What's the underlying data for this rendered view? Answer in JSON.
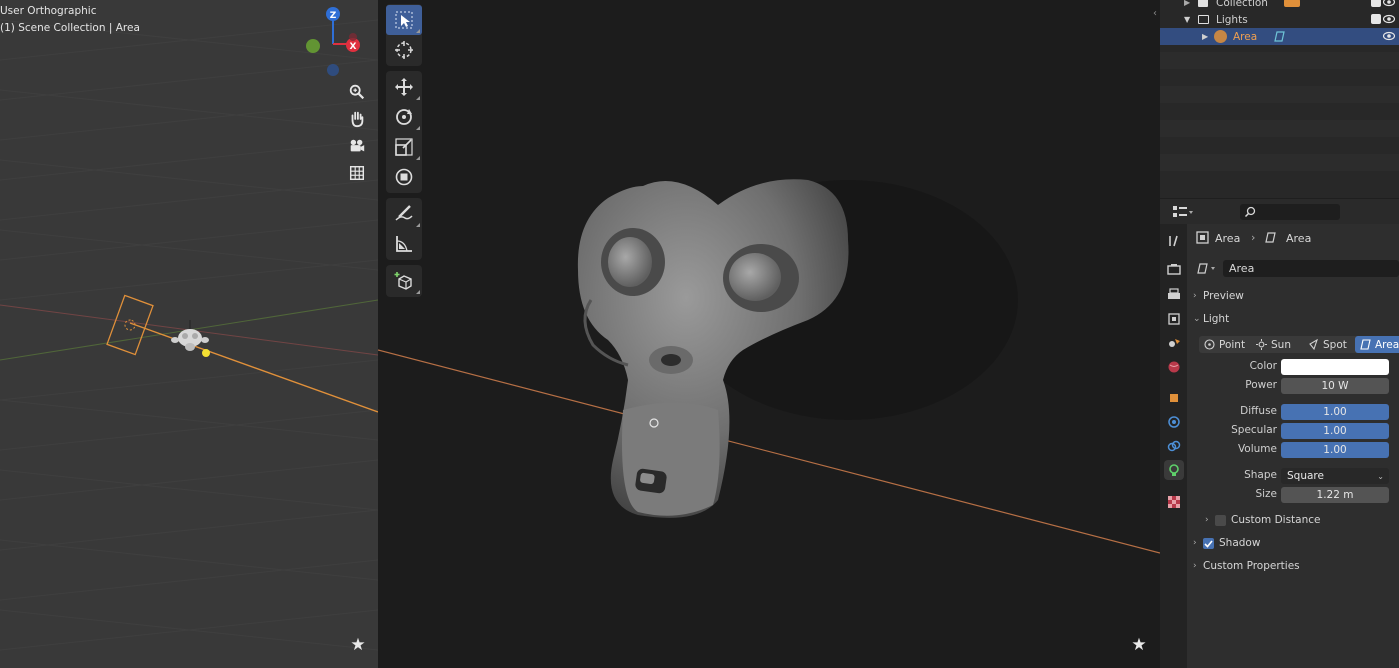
{
  "viewport_left": {
    "view_name": "User Orthographic",
    "collection_info": "(1) Scene Collection | Area",
    "gizmo": {
      "z_label": "Z",
      "x_label": "X",
      "z_color": "#2f6fd6",
      "x_color": "#e0303f",
      "y_color": "#6aa432"
    },
    "nav_icons": [
      "zoom-icon",
      "hand-pan-icon",
      "camera-icon",
      "grid-icon"
    ],
    "star_glyph": "★"
  },
  "viewport_center": {
    "tools": [
      "select-box",
      "cursor",
      "move",
      "rotate",
      "scale",
      "transform",
      "annotate",
      "measure",
      "add-cube"
    ],
    "star_glyph": "★"
  },
  "outliner": {
    "rows": [
      {
        "label": "Collection"
      },
      {
        "label": "Lights"
      },
      {
        "label": "Area"
      }
    ]
  },
  "properties": {
    "breadcrumb": {
      "object": "Area",
      "data": "Area"
    },
    "datablock_name": "Area",
    "sections": {
      "preview": "Preview",
      "light": "Light",
      "custom_distance": "Custom Distance",
      "shadow": "Shadow",
      "custom_properties": "Custom Properties"
    },
    "light_types": [
      "Point",
      "Sun",
      "Spot",
      "Area"
    ],
    "active_light_type": "Area",
    "fields": {
      "color_label": "Color",
      "color_value": "#ffffff",
      "power_label": "Power",
      "power_value": "10 W",
      "diffuse_label": "Diffuse",
      "diffuse_value": "1.00",
      "specular_label": "Specular",
      "specular_value": "1.00",
      "volume_label": "Volume",
      "volume_value": "1.00",
      "shape_label": "Shape",
      "shape_value": "Square",
      "size_label": "Size",
      "size_value": "1.22 m"
    },
    "shadow_enabled": true,
    "custom_distance_enabled": false
  },
  "colors": {
    "accent": "#4772b3",
    "selection": "#334d80",
    "light_orange": "#e0903a"
  }
}
